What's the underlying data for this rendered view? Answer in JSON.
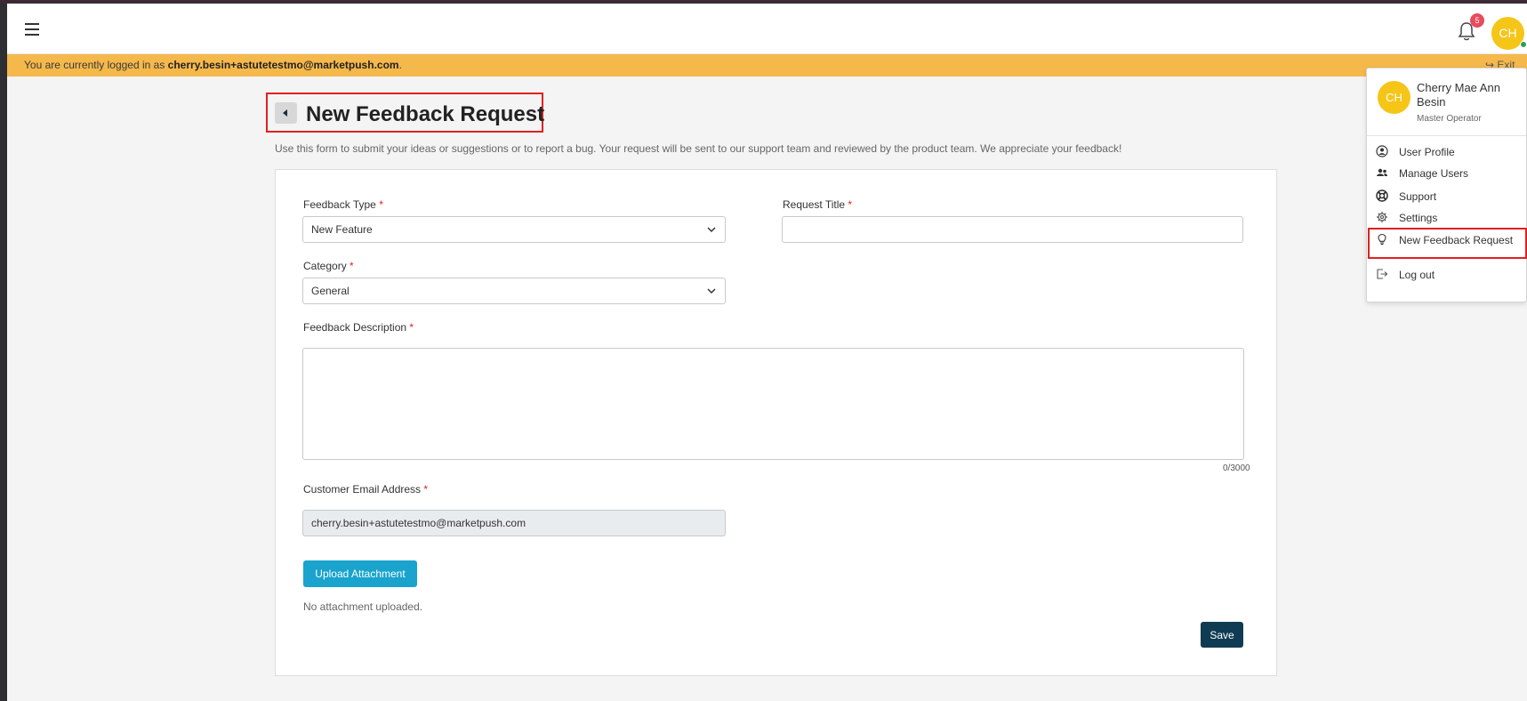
{
  "header": {
    "notification_count": "5",
    "avatar_initials": "CH"
  },
  "banner": {
    "prefix": "You are currently logged in as ",
    "email": "cherry.besin+astutetestmo@marketpush.com",
    "suffix": ".",
    "exit_label": "Exit"
  },
  "page": {
    "title": "New Feedback Request",
    "intro": "Use this form to submit your ideas or suggestions or to report a bug. Your request will be sent to our support team and reviewed by the product team. We appreciate your feedback!"
  },
  "form": {
    "feedback_type_label": "Feedback Type",
    "feedback_type_value": "New Feature",
    "request_title_label": "Request Title",
    "request_title_value": "",
    "category_label": "Category",
    "category_value": "General",
    "description_label": "Feedback Description",
    "description_value": "",
    "char_counter": "0/3000",
    "email_label": "Customer Email Address",
    "email_value": "cherry.besin+astutetestmo@marketpush.com",
    "upload_label": "Upload Attachment",
    "no_attachment": "No attachment uploaded.",
    "save_label": "Save",
    "required_mark": "*"
  },
  "user_menu": {
    "initials": "CH",
    "name": "Cherry Mae Ann Besin",
    "role": "Master Operator",
    "items": [
      {
        "label": "User Profile",
        "icon": "user-circle-icon"
      },
      {
        "label": "Manage Users",
        "icon": "users-icon"
      },
      {
        "label": "Support",
        "icon": "lifebuoy-icon"
      },
      {
        "label": "Settings",
        "icon": "gear-icon"
      },
      {
        "label": "New Feedback Request",
        "icon": "lightbulb-icon"
      },
      {
        "label": "Log out",
        "icon": "logout-icon"
      }
    ]
  },
  "colors": {
    "banner": "#f5b84b",
    "upload_button": "#19a3cd",
    "save_button": "#0f3c52",
    "avatar": "#f5c518",
    "badge": "#e74c5c",
    "highlight": "#e02020"
  }
}
